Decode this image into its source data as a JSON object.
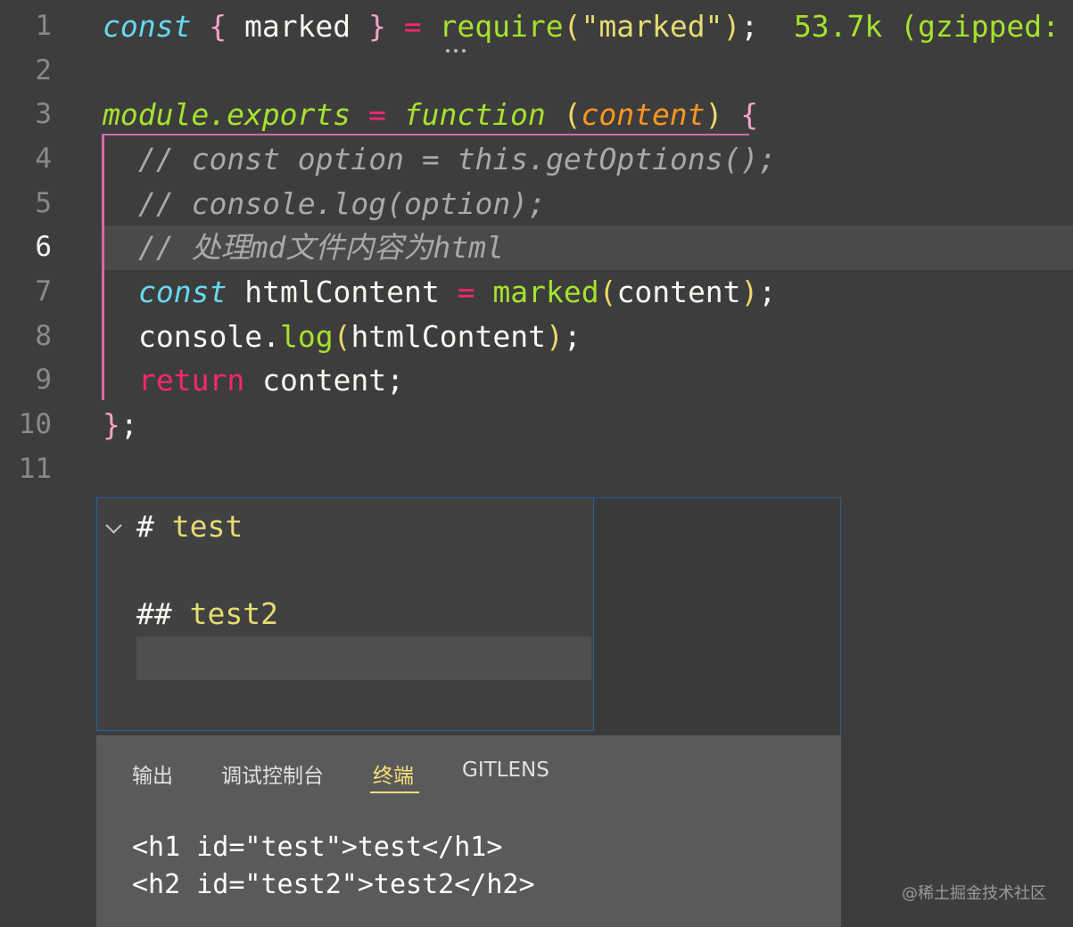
{
  "editor": {
    "line_numbers": [
      "1",
      "2",
      "3",
      "4",
      "5",
      "6",
      "7",
      "8",
      "9",
      "10",
      "11"
    ],
    "active_line": "6",
    "l1": {
      "const": "const",
      "open": "{",
      "name": " marked ",
      "close": "}",
      "eq": " = ",
      "req": "require",
      "po": "(",
      "str": "\"marked\"",
      "pc": ")",
      "semi": ";",
      "size": "53.7k (gzipped:"
    },
    "l3": {
      "obj": "module.exports",
      "eq": " = ",
      "fn": "function",
      "po": "(",
      "param": "content",
      "pc": ")",
      "brace": "{"
    },
    "l4": "// const option = this.getOptions();",
    "l5": "// console.log(option);",
    "l6": "// 处理md文件内容为html",
    "l7": {
      "const": "const",
      "name": " htmlContent ",
      "eq": "= ",
      "fn": "marked",
      "po": "(",
      "arg": "content",
      "pc": ")",
      "semi": ";"
    },
    "l8": {
      "obj": "console.",
      "fn": "log",
      "po": "(",
      "arg": "htmlContent",
      "pc": ")",
      "semi": ";"
    },
    "l9": {
      "ret": "return",
      "rest": " content;"
    },
    "l10": {
      "brace": "}",
      "semi": ";"
    }
  },
  "markdown_preview": {
    "h1_hash": "# ",
    "h1_text": "test",
    "h2_hash": "## ",
    "h2_text": "test2"
  },
  "panel": {
    "tabs": [
      "输出",
      "调试控制台",
      "终端",
      "GITLENS"
    ],
    "active_tab": "终端",
    "output_lines": [
      "<h1 id=\"test\">test</h1>",
      "<h2 id=\"test2\">test2</h2>"
    ]
  },
  "watermark": "@稀土掘金技术社区"
}
